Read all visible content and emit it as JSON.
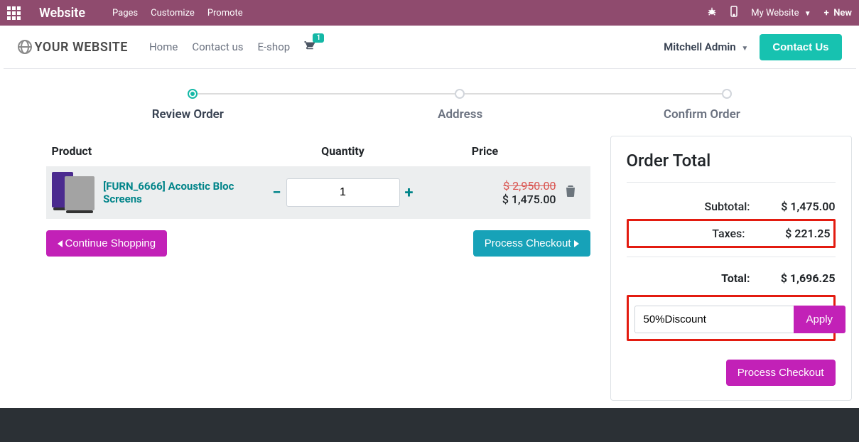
{
  "topbar": {
    "brand": "Website",
    "links": [
      "Pages",
      "Customize",
      "Promote"
    ],
    "site_menu": "My Website",
    "new": "New"
  },
  "header": {
    "logo_text": "YOUR WEBSITE",
    "nav": {
      "home": "Home",
      "contact": "Contact us",
      "eshop": "E-shop"
    },
    "cart_count": "1",
    "user": "Mitchell Admin",
    "contact_btn": "Contact Us"
  },
  "wizard": {
    "review": "Review Order",
    "address": "Address",
    "confirm": "Confirm Order"
  },
  "table": {
    "head": {
      "product": "Product",
      "quantity": "Quantity",
      "price": "Price"
    },
    "row": {
      "name": "[FURN_6666] Acoustic Bloc Screens",
      "qty": "1",
      "price_old": "$ 2,950.00",
      "price_new": "$ 1,475.00"
    }
  },
  "actions": {
    "continue": "Continue Shopping",
    "process": "Process Checkout"
  },
  "order": {
    "title": "Order Total",
    "subtotal_label": "Subtotal:",
    "subtotal_value": "$ 1,475.00",
    "taxes_label": "Taxes:",
    "taxes_value": "$ 221.25",
    "total_label": "Total:",
    "total_value": "$ 1,696.25",
    "promo_value": "50%Discount",
    "apply": "Apply",
    "process": "Process Checkout"
  }
}
